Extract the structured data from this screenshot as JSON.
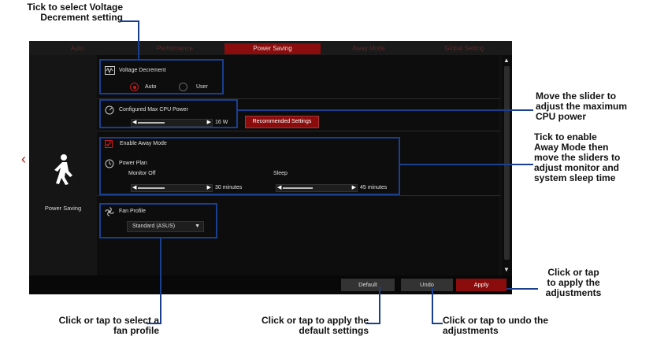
{
  "annotations": {
    "voltage_l1": "Tick to select Voltage",
    "voltage_l2": "Decrement setting",
    "maxcpu_l1": "Move the slider to",
    "maxcpu_l2": "adjust the maximum",
    "maxcpu_l3": "CPU power",
    "away_l1": "Tick to enable",
    "away_l2": "Away Mode then",
    "away_l3": "move the sliders to",
    "away_l4": "adjust monitor and",
    "away_l5": "system sleep time",
    "apply_l1": "Click or tap",
    "apply_l2": "to apply the",
    "apply_l3": "adjustments",
    "fan_l1": "Click or tap to select a",
    "fan_l2": "fan profile",
    "default_l1": "Click or tap to apply the",
    "default_l2": "default settings",
    "undo_l1": "Click or tap to undo the",
    "undo_l2": "adjustments"
  },
  "tabs": [
    "Auto",
    "Performance",
    "Power Saving",
    "Away Mode",
    "Global Setting"
  ],
  "active_tab": "Power Saving",
  "left_pane": {
    "label": "Power Saving"
  },
  "voltage": {
    "title": "Voltage Decrement",
    "option_auto": "Auto",
    "option_user": "User",
    "selected": "Auto"
  },
  "max_cpu": {
    "title": "Configured Max CPU Power",
    "value": "16 W",
    "slider_level": 0.4,
    "recommended_label": "Recommended Settings"
  },
  "away_mode": {
    "checkbox_label": "Enable Away Mode",
    "power_plan_label": "Power Plan",
    "monitor_off_label": "Monitor Off",
    "monitor_off_value": "30 minutes",
    "monitor_level": 0.4,
    "sleep_label": "Sleep",
    "sleep_value": "45 minutes",
    "sleep_level": 0.45
  },
  "fan": {
    "title": "Fan Profile",
    "selected": "Standard (ASUS)"
  },
  "buttons": {
    "default": "Default",
    "undo": "Undo",
    "apply": "Apply"
  },
  "colors": {
    "accent_red": "#8a0c0c",
    "callout_blue": "#1a3f8f",
    "background": "#111111"
  }
}
